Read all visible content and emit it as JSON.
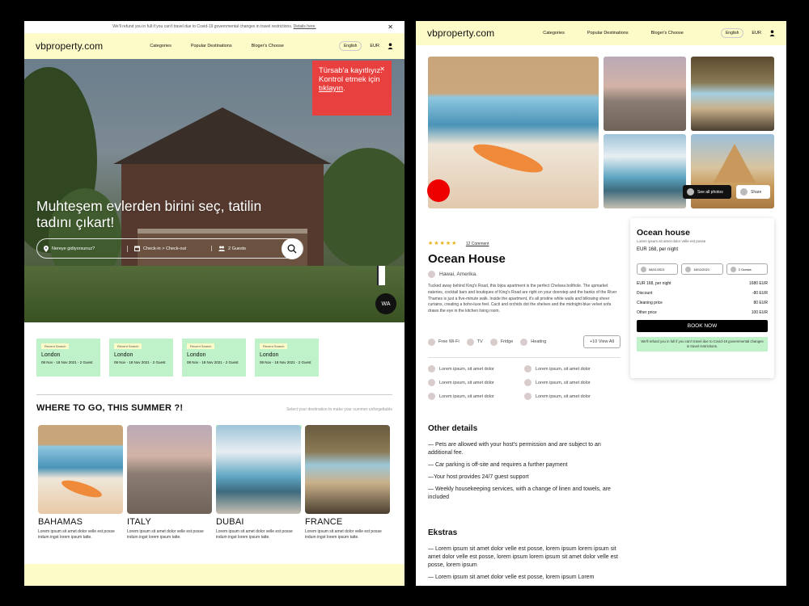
{
  "left": {
    "covid_banner": {
      "text": "We'll refund you in full if you can't travel due to Covid-19 governmental changes in travel restrictions.",
      "link": "Details here."
    },
    "nav": {
      "logo": "vbproperty.com",
      "links": [
        "Categories",
        "Popular Destinations",
        "Bloger's Choose"
      ],
      "language": "English",
      "currency": "EUR"
    },
    "hero": {
      "headline": "Muhteşem evlerden birini seç, tatilin tadını çıkart!",
      "search": {
        "location_placeholder": "Nereye gidiyorsunuz?",
        "dates_placeholder": "Check-in > Check-out",
        "guests": "2 Guests"
      },
      "toast": {
        "text": "Türsab'a kayıtlıyız. Kontrol etmek için",
        "link": "tıklayın",
        "suffix": "."
      },
      "whatsapp_label": "WA"
    },
    "recent_searches": [
      {
        "badge": "Recent Search",
        "city": "London",
        "details": "08 Nov - 18 Nov 2021 - 2 Guest"
      },
      {
        "badge": "Recent Search",
        "city": "London",
        "details": "08 Nov - 18 Nov 2021 - 2 Guest"
      },
      {
        "badge": "Recent Search",
        "city": "London",
        "details": "08 Nov - 18 Nov 2021 - 2 Guest"
      },
      {
        "badge": "Recent Search",
        "city": "London",
        "details": "08 Nov - 18 Nov 2021 - 2 Guest"
      }
    ],
    "destinations_section": {
      "title": "WHERE TO GO, THIS SUMMER ?!",
      "subtitle": "Select your destination to make your summer unforgettable",
      "items": [
        {
          "name": "BAHAMAS",
          "desc": "Lorem ipsum sit amet dolor velle est posse indum ingst lorem ipsum tatte."
        },
        {
          "name": "ITALY",
          "desc": "Lorem ipsum sit amet dolor velle est posse indum ingst lorem ipsum tatte."
        },
        {
          "name": "DUBAI",
          "desc": "Lorem ipsum sit amet dolor velle est posse indum ingst lorem ipsum tatte."
        },
        {
          "name": "FRANCE",
          "desc": "Lorem ipsum sit amet dolor velle est posse indum ingst lorem ipsum tatte."
        }
      ]
    }
  },
  "right": {
    "nav": {
      "logo": "vbproperty.com",
      "links": [
        "Categories",
        "Popular Destinations",
        "Bloger's Choose"
      ],
      "language": "English",
      "currency": "EUR"
    },
    "gallery": {
      "see_all": "See all photos",
      "share": "Share"
    },
    "listing": {
      "stars": "★★★★★",
      "comments": "12 Comment",
      "title": "Ocean House",
      "location": "Hawai, Amerika.",
      "description": "Tucked away behind King's Road, this bijou apartment is the perfect Chelsea bolthole. The upmarket eateries, cocktail bars and boutiques of King's Road are right on your doorstep and the banks of the River Thames is just a five-minute walk. Inside the apartment, it's all pristine white walls and billowing sheer curtains, creating a boho-luxe feel. Cacti and orchids dot the shelves and the midnight-blue velvet sofa draws the eye in the kitchen living room.",
      "amenities": [
        "Free Wi-Fi",
        "TV",
        "Fridge",
        "Heating"
      ],
      "view_all": "+10  View All",
      "features": [
        "Lorem ipsum, sit amet dolor",
        "Lorem ipsum, sit amet dolor",
        "Lorem ipsum, sit amet dolor",
        "Lorem ipsum, sit amet dolor",
        "Lorem ipsum, sit amet dolor",
        "Lorem ipsum, sit amet dolor"
      ],
      "other_details_title": "Other details",
      "other_details": [
        "— Pets are allowed with your host's permission and are subject to an additional fee.",
        "— Car parking is off-site and requires a further payment",
        "—Your host provides 24/7 guest support",
        "— Weekly housekeeping services, with a change of linen and towels, are included"
      ],
      "ekstras_title": "Ekstras",
      "ekstras": [
        "— Lorem ipsum sit amet dolor velle est posse, lorem ipsum lorem ipsum sit amet dolor velle est posse, lorem ipsum lorem ipsum sit amet dolor velle est posse, lorem ipsum",
        "— Lorem ipsum sit amet dolor velle est posse, lorem ipsum Lorem"
      ]
    },
    "booking": {
      "title": "Ocean house",
      "subtitle": "Lorem ipsum sit amet dolor velle est posse",
      "price": "EUR 168, per night",
      "checkin": "08/11/2021",
      "checkout": "18/11/2021",
      "guests": "2 Guests",
      "rows": [
        {
          "label": "EUR 168, per night",
          "value": "1680 EUR"
        },
        {
          "label": "Discount",
          "value": "-80 EUR"
        },
        {
          "label": "Cleaning price",
          "value": "80 EUR"
        },
        {
          "label": "Other price",
          "value": "100 EUR"
        }
      ],
      "book_now": "BOOK NOW",
      "refund_note": "We'll refund you in full if you can't travel due to Covid-19 governmental changes in travel restrictions."
    }
  }
}
